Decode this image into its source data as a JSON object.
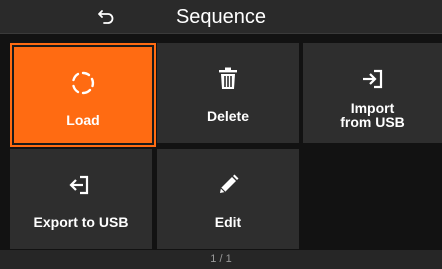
{
  "header": {
    "title": "Sequence",
    "back_icon": "back-arrow-icon"
  },
  "tiles": [
    {
      "label": "Load",
      "icon": "loading-spinner-icon",
      "selected": true,
      "accent": "#ff6b12"
    },
    {
      "label": "Delete",
      "icon": "trash-icon",
      "selected": false
    },
    {
      "label_line1": "Import",
      "label_line2": "from USB",
      "icon": "import-arrow-icon",
      "selected": false
    },
    {
      "label": "Export to USB",
      "icon": "export-arrow-icon",
      "selected": false
    },
    {
      "label": "Edit",
      "icon": "pencil-icon",
      "selected": false
    }
  ],
  "footer": {
    "page_indicator": "1 / 1"
  }
}
